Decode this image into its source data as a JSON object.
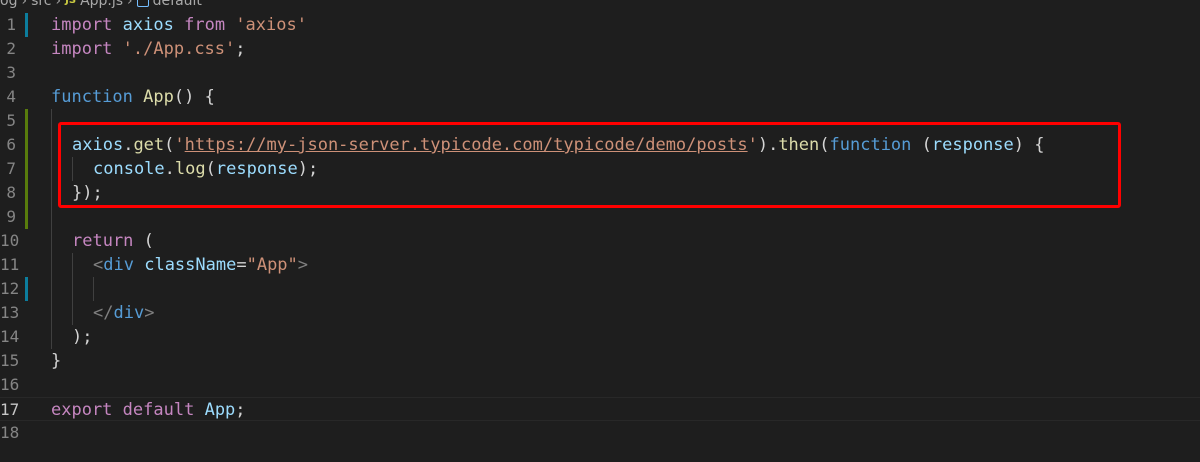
{
  "breadcrumb": {
    "items": [
      "og",
      "src",
      "App.js",
      "default"
    ],
    "js_badge": "JS"
  },
  "colors": {
    "background": "#1e1e1e",
    "keyword": "#c586c0",
    "storage": "#569cd6",
    "function": "#dcdcaa",
    "variable": "#9cdcfe",
    "string": "#ce9178",
    "highlight_box": "#ff0000",
    "git_added": "#587c0c",
    "git_modified": "#0c7d9d"
  },
  "lines": [
    {
      "number": "1"
    },
    {
      "number": "2"
    },
    {
      "number": "3"
    },
    {
      "number": "4"
    },
    {
      "number": "5"
    },
    {
      "number": "6"
    },
    {
      "number": "7"
    },
    {
      "number": "8"
    },
    {
      "number": "9"
    },
    {
      "number": "10"
    },
    {
      "number": "11"
    },
    {
      "number": "12"
    },
    {
      "number": "13"
    },
    {
      "number": "14"
    },
    {
      "number": "15"
    },
    {
      "number": "16"
    },
    {
      "number": "17"
    },
    {
      "number": "18"
    }
  ],
  "code": {
    "l1": {
      "import": "import",
      "name": "axios",
      "from": "from",
      "module": "'axios'"
    },
    "l2": {
      "import": "import",
      "module": "'./App.css'",
      "semi": ";"
    },
    "l4": {
      "function": "function",
      "name": "App",
      "rest": "() {"
    },
    "l6": {
      "obj": "axios",
      "dot": ".",
      "method": "get",
      "open": "(",
      "q1": "'",
      "url": "https://my-json-server.typicode.com/typicode/demo/posts",
      "q2": "'",
      "close": ").",
      "then": "then",
      "open2": "(",
      "function": "function",
      "space": " (",
      "param": "response",
      "rest": ") {"
    },
    "l7": {
      "obj": "console",
      "dot": ".",
      "method": "log",
      "open": "(",
      "arg": "response",
      "rest": ");"
    },
    "l8": {
      "text": "});"
    },
    "l10": {
      "return": "return",
      "rest": " ("
    },
    "l11": {
      "lt": "<",
      "tag": "div",
      "attr": "className",
      "eq": "=",
      "val": "\"App\"",
      "gt": ">"
    },
    "l13": {
      "lt": "</",
      "tag": "div",
      "gt": ">"
    },
    "l14": {
      "text": ");"
    },
    "l15": {
      "text": "}"
    },
    "l17": {
      "export": "export",
      "default": "default",
      "name": "App",
      "semi": ";"
    }
  }
}
